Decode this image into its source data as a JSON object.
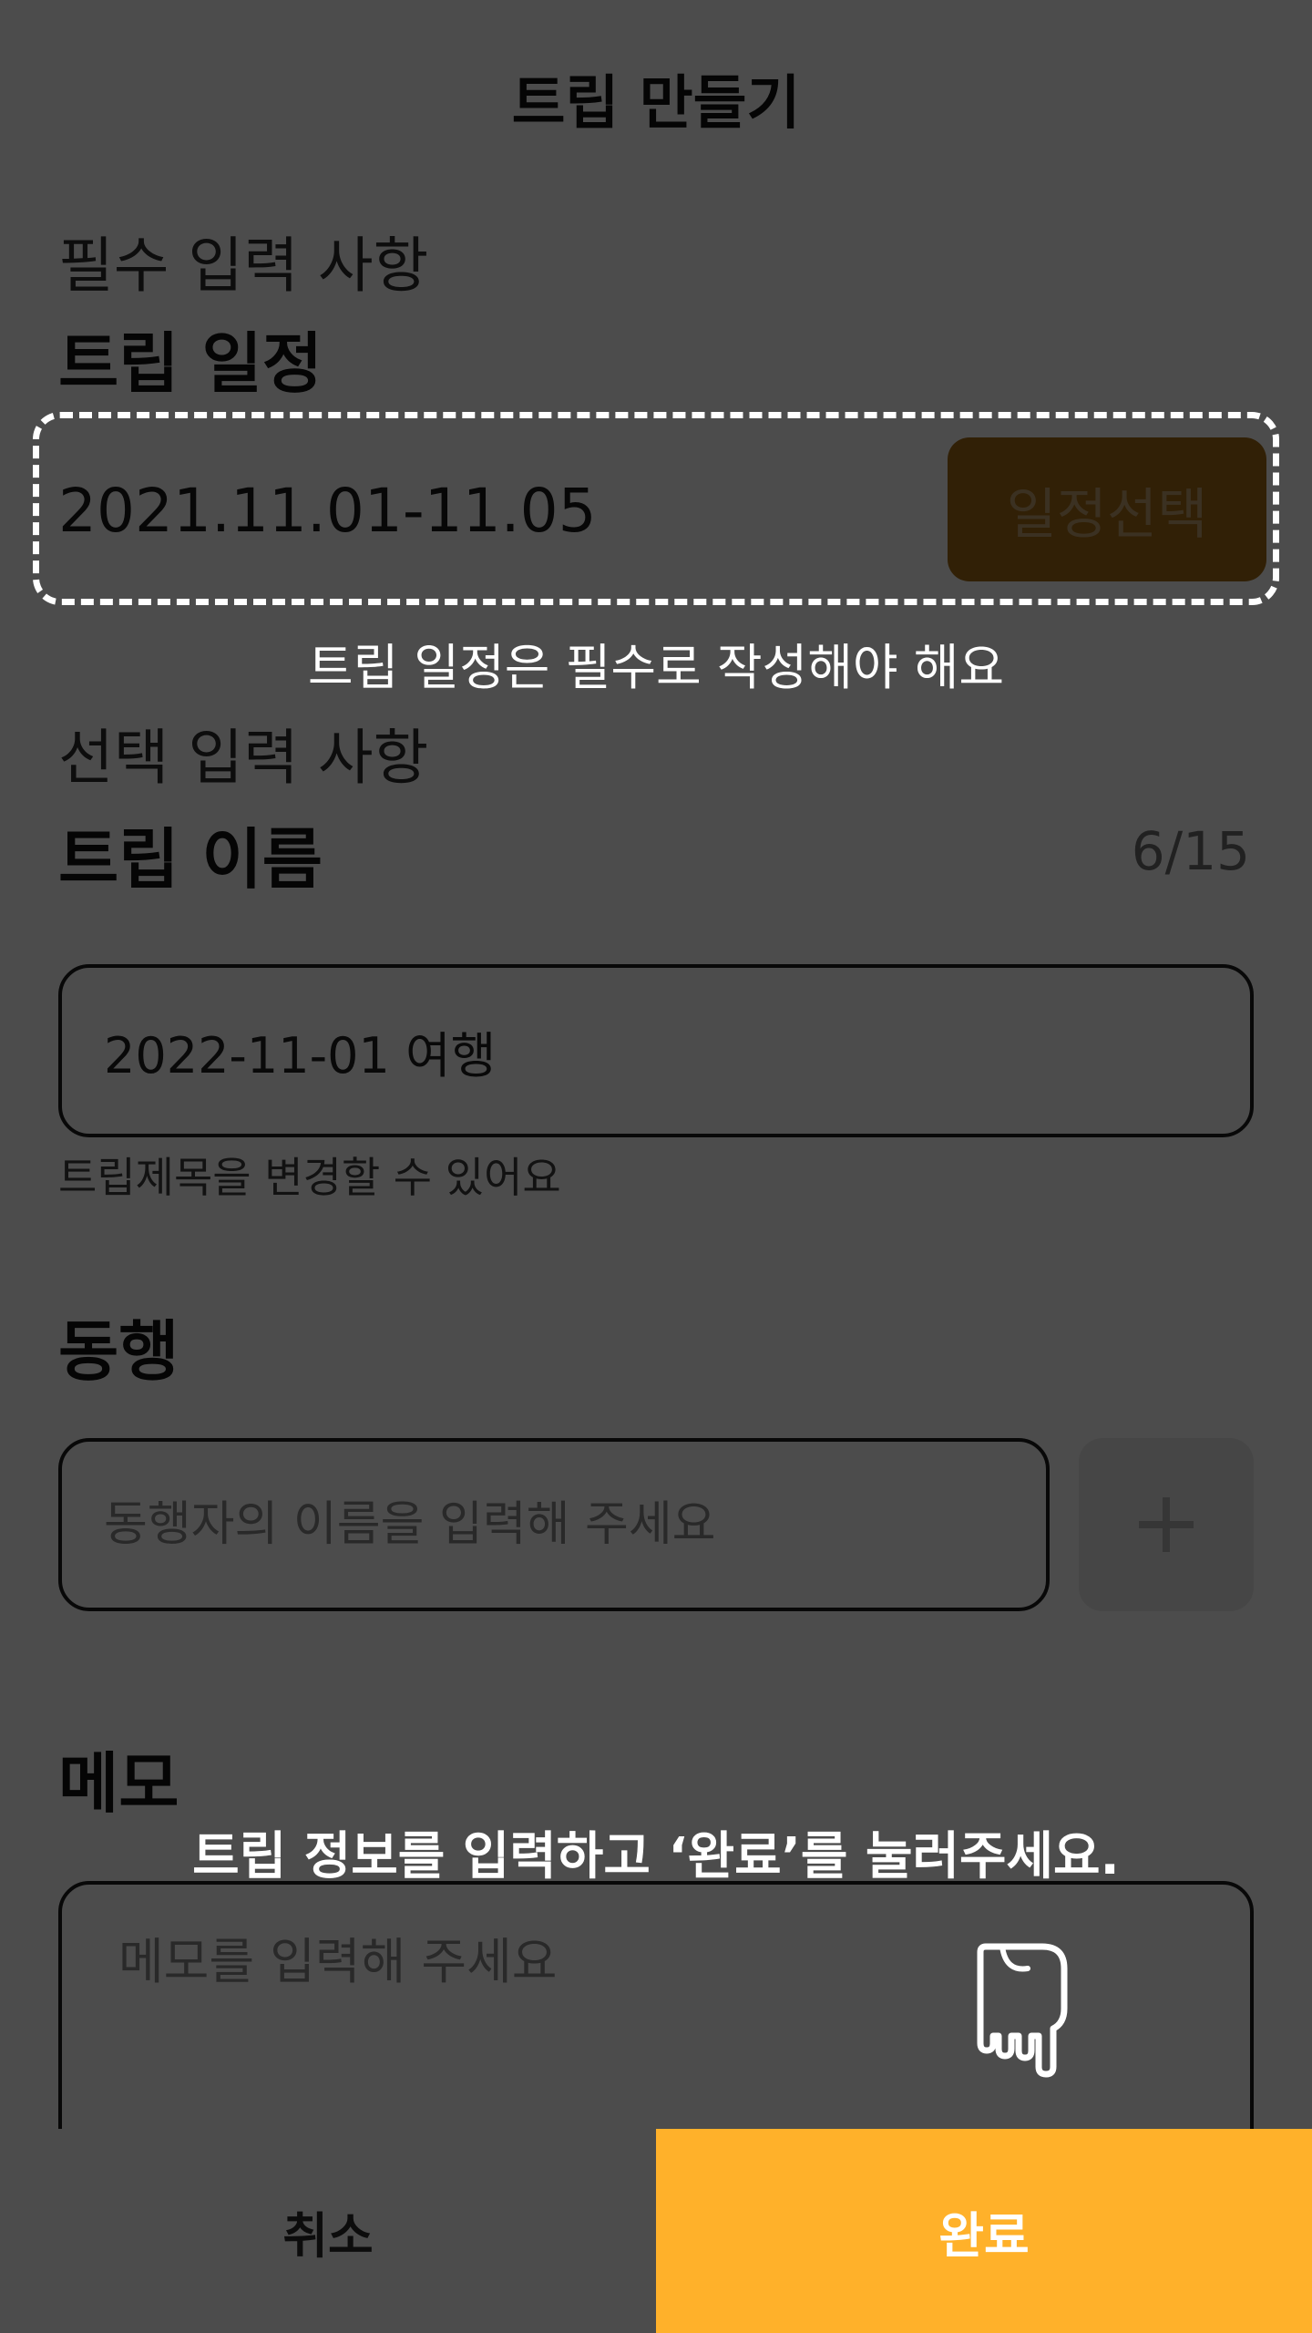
{
  "header": {
    "title": "트립 만들기"
  },
  "required_section": {
    "caption": "필수 입력 사항",
    "heading": "트립 일정",
    "date_value": "2021.11.01-11.05",
    "select_button_label": "일정선택"
  },
  "optional_section": {
    "caption": "선택 입력 사항",
    "name_heading": "트립 이름",
    "name_counter": "6/15",
    "name_value": "2022-11-01 여행",
    "name_hint": "트립제목을 변경할 수 있어요"
  },
  "companion": {
    "heading": "동행",
    "placeholder": "동행자의 이름을 입력해 주세요",
    "add_icon": "plus-icon"
  },
  "memo": {
    "heading": "메모",
    "placeholder": "메모를 입력해 주세요"
  },
  "bottom_bar": {
    "cancel_label": "취소",
    "done_label": "완료"
  },
  "coachmark": {
    "schedule_required_text": "트립 일정은 필수로 작성해야 해요",
    "instruction_text": "트립 정보를 입력하고 ‘완료’를 눌러주세요.",
    "pointer_icon": "pointing-hand-icon"
  },
  "colors": {
    "accent": "#ffb12a",
    "overlay": "rgba(0,0,0,0.70)"
  }
}
